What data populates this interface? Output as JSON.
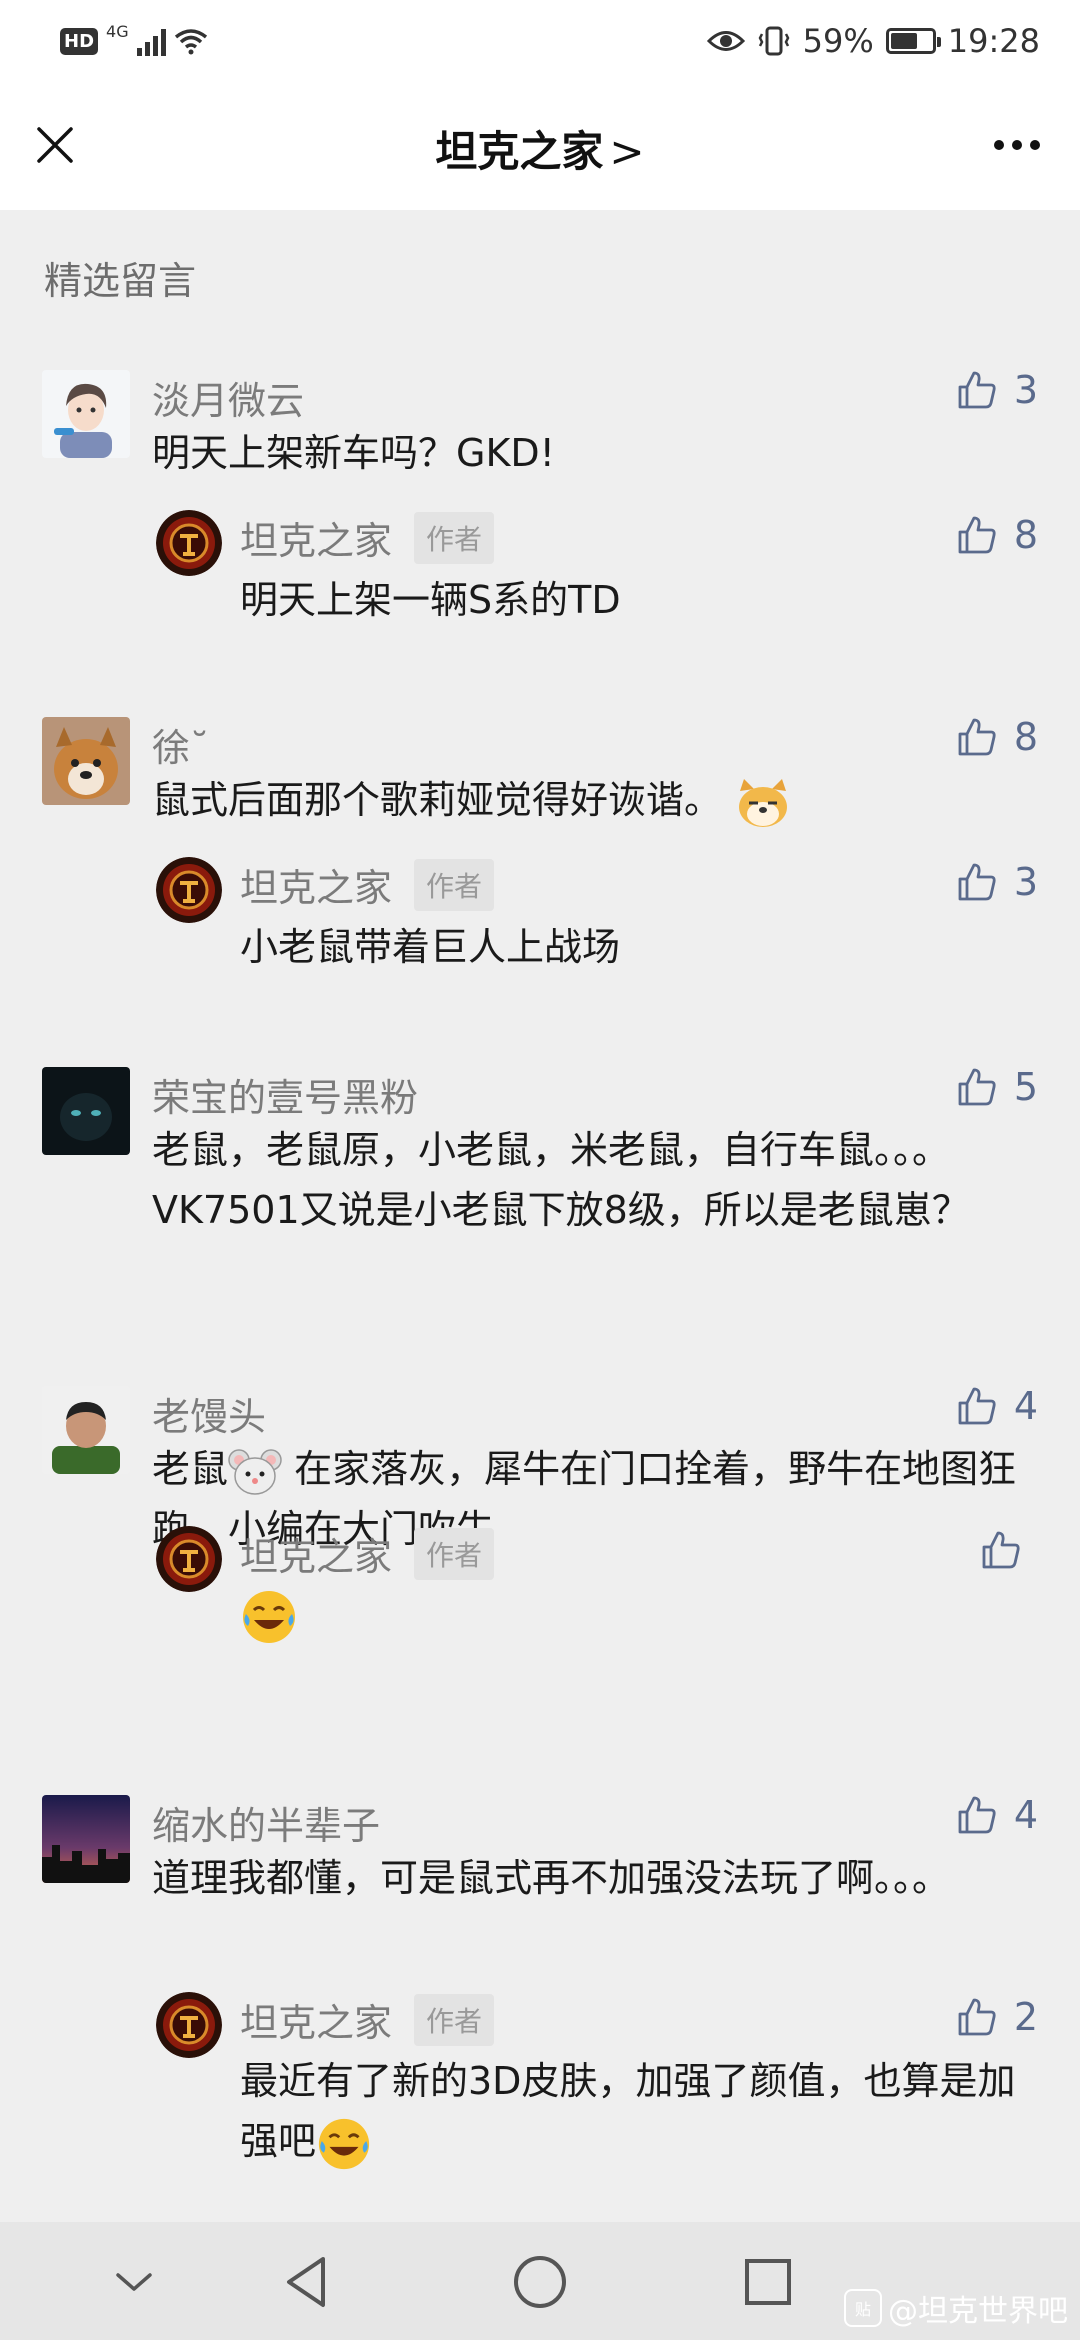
{
  "status_bar": {
    "hd": "HD",
    "network": "4G",
    "battery": "59%",
    "battery_fill": 0.59,
    "time": "19:28"
  },
  "header": {
    "title": "坦克之家",
    "title_chevron": ">"
  },
  "section_title": "精选留言",
  "comments": [
    {
      "user": "淡月微云",
      "text": "明天上架新车吗？GKD!",
      "likes": "3",
      "reply": {
        "user": "坦克之家",
        "badge": "作者",
        "text": "明天上架一辆S系的TD",
        "likes": "8"
      }
    },
    {
      "user": "徐˘",
      "text": "鼠式后面那个歌莉娅觉得好诙谐。",
      "emoji": "dog-face",
      "likes": "8",
      "reply": {
        "user": "坦克之家",
        "badge": "作者",
        "text": "小老鼠带着巨人上战场",
        "likes": "3"
      }
    },
    {
      "user": "荣宝的壹号黑粉",
      "text": "老鼠，老鼠原，小老鼠，米老鼠，自行车鼠。。。VK7501又说是小老鼠下放8级，所以是老鼠崽？",
      "likes": "5"
    },
    {
      "user": "老馒头",
      "text_a": "老鼠",
      "emoji": "mouse-face",
      "text_b": " 在家落灰，犀牛在门口拴着，野牛在地图狂跑，小编在大门吹牛",
      "likes": "4",
      "reply": {
        "user": "坦克之家",
        "badge": "作者",
        "emoji": "crying-laughing",
        "likes": ""
      }
    },
    {
      "user": "缩水的半辈子",
      "text": "道理我都懂，可是鼠式再不加强没法玩了啊。。。",
      "likes": "4",
      "reply": {
        "user": "坦克之家",
        "badge": "作者",
        "text": "最近有了新的3D皮肤，加强了颜值，也算是加强吧",
        "emoji": "crying-laughing",
        "likes": "2"
      }
    }
  ],
  "watermark": {
    "logo": "贴",
    "text": "@坦克世界吧"
  },
  "icons": {
    "close": "close-icon",
    "more": "more-icon",
    "thumb": "thumbs-up-icon",
    "nav": [
      "chevron-down-icon",
      "back-triangle-icon",
      "home-circle-icon",
      "recents-square-icon"
    ]
  },
  "colors": {
    "like": "#5a6a8c",
    "background": "#efefef",
    "header": "#ffffff"
  }
}
